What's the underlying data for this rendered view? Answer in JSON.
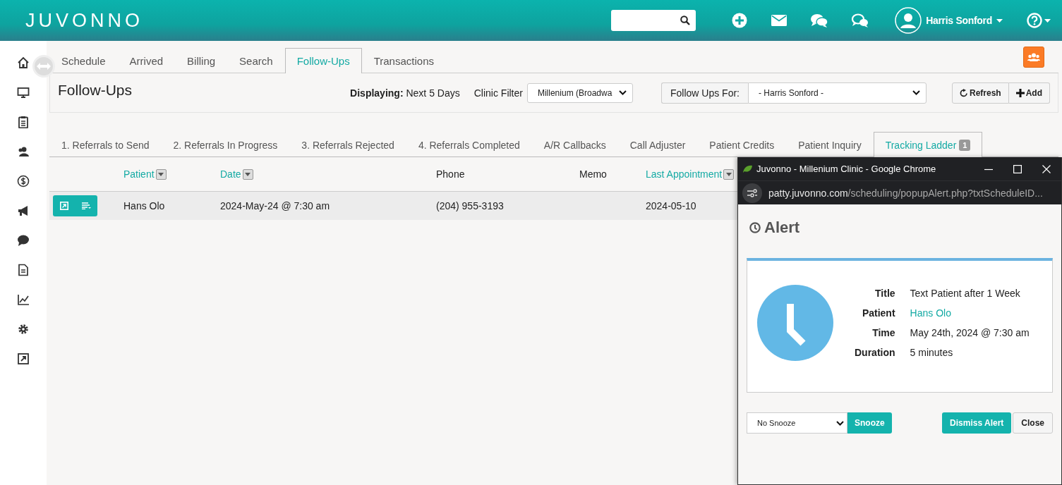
{
  "header": {
    "logo": "JUVONNO",
    "user_name": "Harris Sonford"
  },
  "main_tabs": [
    {
      "label": "Schedule",
      "selected": false
    },
    {
      "label": "Arrived",
      "selected": false
    },
    {
      "label": "Billing",
      "selected": false
    },
    {
      "label": "Search",
      "selected": false
    },
    {
      "label": "Follow-Ups",
      "selected": true
    },
    {
      "label": "Transactions",
      "selected": false
    }
  ],
  "toolbar": {
    "title": "Follow-Ups",
    "displaying": "**Displaying:** Next 5 Days",
    "clinic_filter_label": "Clinic Filter",
    "clinic_filter_value": "Millenium (Broadwa",
    "follow_ups_for_label": "Follow Ups For:",
    "follow_ups_for_value": "- Harris Sonford -",
    "buttons": [
      {
        "kind": "refresh",
        "label": "Refresh"
      },
      {
        "kind": "add",
        "label": "Add"
      }
    ]
  },
  "sub_tabs": [
    {
      "label": "1. Referrals to Send",
      "selected": false
    },
    {
      "label": "2. Referrals In Progress",
      "selected": false
    },
    {
      "label": "3. Referrals Rejected",
      "selected": false
    },
    {
      "label": "4. Referrals Completed",
      "selected": false
    },
    {
      "label": "A/R Callbacks",
      "selected": false
    },
    {
      "label": "Call Adjuster",
      "selected": false
    },
    {
      "label": "Patient Credits",
      "selected": false
    },
    {
      "label": "Patient Inquiry",
      "selected": false
    },
    {
      "label": "Tracking Ladder",
      "selected": true,
      "badge": "1"
    }
  ],
  "table": {
    "columns": [
      {
        "label": "Patient",
        "sortable": true
      },
      {
        "label": "Date",
        "sortable": true
      },
      {
        "label": "Phone",
        "sortable": false
      },
      {
        "label": "Memo",
        "sortable": false
      },
      {
        "label": "Last Appointment",
        "sortable": true
      }
    ],
    "rows": [
      {
        "cells": [
          "Hans Olo",
          "2024-May-24 @ 7:30 am",
          "(204) 955-3193",
          null,
          "2024-05-10"
        ]
      }
    ]
  },
  "popup": {
    "window_title": "Juvonno - Millenium Clinic - Google Chrome",
    "url_host": "patty.juvonno.com",
    "url_path": "/scheduling/popupAlert.php?txtScheduleID...",
    "heading": "Alert",
    "fields": [
      {
        "label": "Title",
        "value": "Text Patient after 1 Week",
        "kind": "text"
      },
      {
        "label": "Patient",
        "value": "Hans Olo",
        "kind": "link"
      },
      {
        "label": "Time",
        "value": "May 24th, 2024 @ 7:30 am",
        "kind": "text"
      },
      {
        "label": "Duration",
        "value": "5 minutes",
        "kind": "text"
      }
    ],
    "snooze_value": "No Snooze",
    "snooze_button": "Snooze",
    "dismiss_button": "Dismiss Alert",
    "close_button": "Close"
  }
}
